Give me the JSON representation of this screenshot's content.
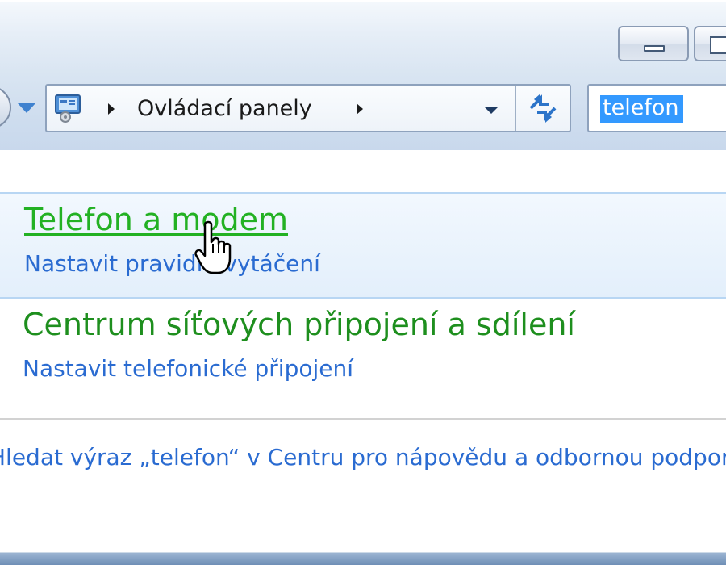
{
  "window": {
    "minimize_icon": "minimize-icon",
    "maximize_icon": "maximize-icon"
  },
  "nav": {
    "back_icon": "back-arrow-icon",
    "history_icon": "chevron-down-icon"
  },
  "address_bar": {
    "icon": "control-panel-icon",
    "breadcrumb": "Ovládací panely",
    "dropdown_icon": "chevron-down-icon",
    "refresh_icon": "refresh-icon"
  },
  "search": {
    "value": "telefon"
  },
  "results": [
    {
      "title": "Telefon a modem",
      "subtitle": "Nastavit pravidla vytáčení"
    },
    {
      "title": "Centrum síťových připojení a sdílení",
      "subtitle": "Nastavit telefonické připojení"
    }
  ],
  "help": {
    "text": "Hledat výraz „telefon“ v Centru pro nápovědu a odbornou podporu"
  },
  "colors": {
    "link_green": "#1e8f1e",
    "link_hover_green": "#23b123",
    "task_blue": "#2a6bd1",
    "selection": "#3399ff"
  }
}
